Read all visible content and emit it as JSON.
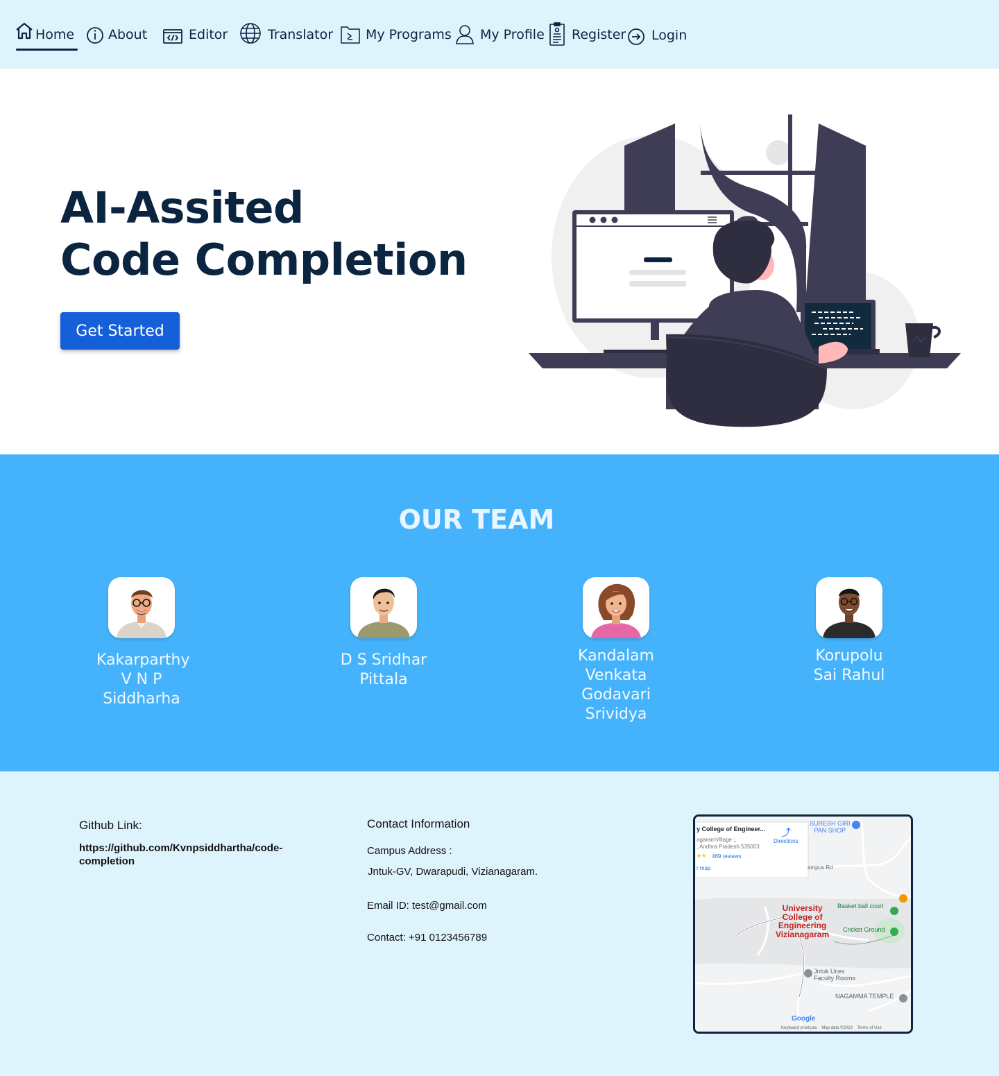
{
  "nav": {
    "items": [
      {
        "label": "Home",
        "icon": "home-icon",
        "active": true
      },
      {
        "label": "About",
        "icon": "info-icon"
      },
      {
        "label": "Editor",
        "icon": "code-icon"
      },
      {
        "label": "Translator",
        "icon": "globe-icon"
      },
      {
        "label": "My Programs",
        "icon": "terminal-icon"
      },
      {
        "label": "My Profile",
        "icon": "user-icon"
      },
      {
        "label": "Register",
        "icon": "clipboard-icon"
      },
      {
        "label": "Login",
        "icon": "login-icon"
      }
    ]
  },
  "hero": {
    "title_line1": "AI-Assited",
    "title_line2": "Code Completion",
    "cta_label": "Get Started"
  },
  "team": {
    "heading": "OUR TEAM",
    "members": [
      {
        "name": "Kakarparthy V N P Siddharha"
      },
      {
        "name": "D S Sridhar Pittala"
      },
      {
        "name": "Kandalam Venkata Godavari Srividya"
      },
      {
        "name": "Korupolu Sai Rahul"
      }
    ]
  },
  "footer": {
    "github_heading": "Github Link:",
    "github_url": "https://github.com/Kvnpsiddhartha/code-completion",
    "contact_heading": "Contact Information",
    "campus_label": "Campus Address :",
    "campus_value": "Jntuk-GV, Dwarapudi, Vizianagaram.",
    "email": "Email ID: test@gmail.com",
    "phone": "Contact: +91 0123456789"
  },
  "map": {
    "card_title": "y College of Engineer...",
    "card_addr1": "agaramVillage ;,",
    "card_addr2": ", Andhra Pradesh 535003",
    "reviews": "469 reviews",
    "directions": "Directions",
    "view_map": "r map",
    "campus_rd": "ampus Rd",
    "place_main_1": "University",
    "place_main_2": "College of",
    "place_main_3": "Engineering",
    "place_main_4": "Vizianagaram",
    "pan_shop_1": "SURESH GIRI",
    "pan_shop_2": "PAN SHOP",
    "basketball": "Basket ball court",
    "cricket": "Cricket Ground",
    "faculty_1": "Jntuk Ucev",
    "faculty_2": "Faculty Rooms",
    "temple": "NAGAMMA TEMPLE",
    "google": "Google",
    "legal": "Keyboard shortcuts    Map data ©2023    Terms of Use"
  }
}
